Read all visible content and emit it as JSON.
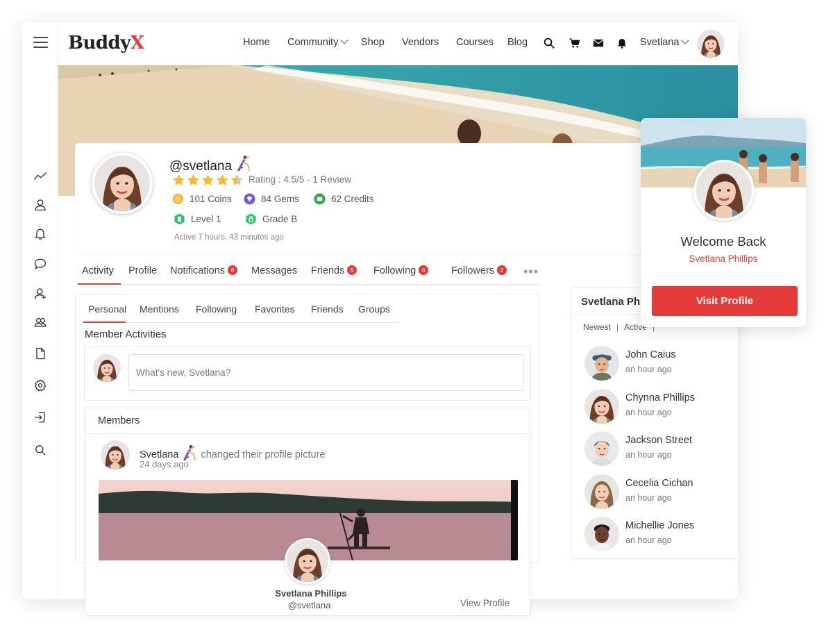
{
  "brand": {
    "logo_main": "Buddy",
    "logo_accent": "X",
    "accent_color": "#e43a3a"
  },
  "nav": {
    "items": [
      "Home",
      "Community",
      "Shop",
      "Vendors",
      "Courses",
      "Blog"
    ],
    "icons": [
      "search-icon",
      "cart-icon",
      "mail-icon",
      "bell-icon"
    ],
    "user_label": "Svetlana"
  },
  "sidebar": {
    "icons": [
      "activity-icon",
      "profile-icon",
      "notifications-icon",
      "messages-icon",
      "add-friend-icon",
      "groups-icon",
      "document-icon",
      "settings-icon",
      "logout-icon",
      "search-icon"
    ]
  },
  "profile": {
    "handle": "@svetlana",
    "rating_stars": 4.5,
    "rating_text": "Rating : 4.5/5 - 1 Review",
    "coins": "101 Coins",
    "gems": "84 Gems",
    "credits": "62 Credits",
    "level": "Level 1",
    "grade": "Grade B",
    "active": "Active 7 hours, 43 minutes ago"
  },
  "tabs": [
    {
      "label": "Activity",
      "badge": ""
    },
    {
      "label": "Profile",
      "badge": ""
    },
    {
      "label": "Notifications",
      "badge": "8"
    },
    {
      "label": "Messages",
      "badge": ""
    },
    {
      "label": "Friends",
      "badge": "5"
    },
    {
      "label": "Following",
      "badge": "6"
    },
    {
      "label": "Followers",
      "badge": "2"
    }
  ],
  "subtabs": [
    "Personal",
    "Mentions",
    "Following",
    "Favorites",
    "Friends",
    "Groups"
  ],
  "activity": {
    "section_title": "Member Activities",
    "post_placeholder": "What's new, Svetlana?",
    "members_heading": "Members",
    "feed_user": "Svetlana",
    "feed_action": "changed their profile picture",
    "feed_time": "24 days ago",
    "card_name": "Svetlana Phillips",
    "card_handle": "@svetlana",
    "view_profile": "View Profile"
  },
  "widget": {
    "title": "Svetlana Phillips",
    "filters": [
      "Newest",
      "Active"
    ],
    "members": [
      {
        "name": "John Caius",
        "time": "an hour ago"
      },
      {
        "name": "Chynna Phillips",
        "time": "an hour ago"
      },
      {
        "name": "Jackson Street",
        "time": "an hour ago"
      },
      {
        "name": "Cecelia Cichan",
        "time": "an hour ago"
      },
      {
        "name": "Michellie Jones",
        "time": "an hour ago"
      }
    ]
  },
  "welcome": {
    "title": "Welcome Back",
    "name": "Svetlana Phillips",
    "button": "Visit Profile"
  }
}
